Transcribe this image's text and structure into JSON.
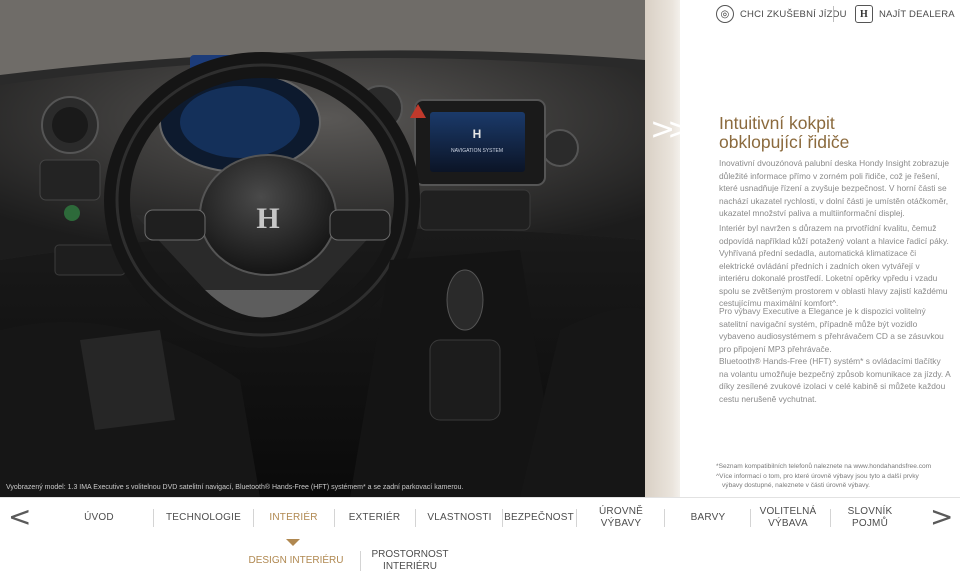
{
  "header": {
    "test_drive_label": "CHCI ZKUŠEBNÍ JÍZDU",
    "test_drive_icon": "steering-wheel-icon",
    "dealer_label": "NAJÍT DEALERA",
    "dealer_icon": "honda-logo-icon"
  },
  "photo": {
    "caption": "Vyobrazený model: 1.3 IMA Executive s volitelnou DVD satelitní navigací, Bluetooth® Hands-Free (HFT) systémem* a se zadní parkovací kamerou.",
    "screen_text": "NAVIGATION SYSTEM"
  },
  "article": {
    "title_line1": "Intuitivní kokpit",
    "title_line2": "obklopující řidiče",
    "paragraphs": [
      "Inovativní dvouzónová palubní deska Hondy Insight zobrazuje důležité informace přímo v zorném poli řidiče, což je řešení, které usnadňuje řízení a zvyšuje bezpečnost. V horní části se nachází ukazatel rychlosti, v dolní části je umístěn otáčkoměr, ukazatel množství paliva a multiinformační displej.",
      "Interiér byl navržen s důrazem na prvotřídní kvalitu, čemuž odpovídá například kůží potažený volant a hlavice řadicí páky. Vyhřívaná přední sedadla, automatická klimatizace či elektrické ovládání předních i zadních oken vytvářejí v interiéru dokonalé prostředí. Loketní opěrky vpředu i vzadu spolu se zvětšeným prostorem v oblasti hlavy zajistí každému cestujícímu maximální komfort^.",
      "Pro výbavy Executive a Elegance je k dispozici volitelný satelitní navigační systém, případně může být vozidlo vybaveno audiosystémem s přehrávačem CD a se zásuvkou pro připojení MP3 přehrávače.",
      "Bluetooth® Hands-Free (HFT) systém* s ovládacími tlačítky na volantu umožňuje bezpečný způsob komunikace za jízdy. A díky zesílené zvukové izolaci v celé kabině si můžete každou cestu nerušeně vychutnat."
    ],
    "footnote1": "*Seznam kompatibilních telefonů naleznete na www.hondahandsfree.com",
    "footnote2_line1": "^Více informací o tom, pro které úrovně výbavy jsou tyto a další prvky",
    "footnote2_line2": "výbavy dostupné, naleznete v části úrovně výbavy."
  },
  "nav": {
    "prev_label": "<",
    "next_label": ">",
    "items": [
      {
        "label": "ÚVOD",
        "active": false
      },
      {
        "label": "TECHNOLOGIE",
        "active": false
      },
      {
        "label": "INTERIÉR",
        "active": true
      },
      {
        "label": "EXTERIÉR",
        "active": false
      },
      {
        "label": "VLASTNOSTI",
        "active": false
      },
      {
        "label": "BEZPEČNOST",
        "active": false
      },
      {
        "label": "ÚROVNĚ VÝBAVY",
        "active": false
      },
      {
        "label": "BARVY",
        "active": false
      },
      {
        "label": "VOLITELNÁ VÝBAVA",
        "active": false
      },
      {
        "label": "SLOVNÍK POJMŮ",
        "active": false
      }
    ],
    "sub_items": [
      {
        "label": "DESIGN INTERIÉRU",
        "active": true
      },
      {
        "label": "PROSTORNOST INTERIÉRU",
        "active": false
      }
    ]
  },
  "colors": {
    "accent": "#b08850",
    "title": "#8b6a3d",
    "panel": "#e6dfd6",
    "text": "#8a8a8a"
  }
}
